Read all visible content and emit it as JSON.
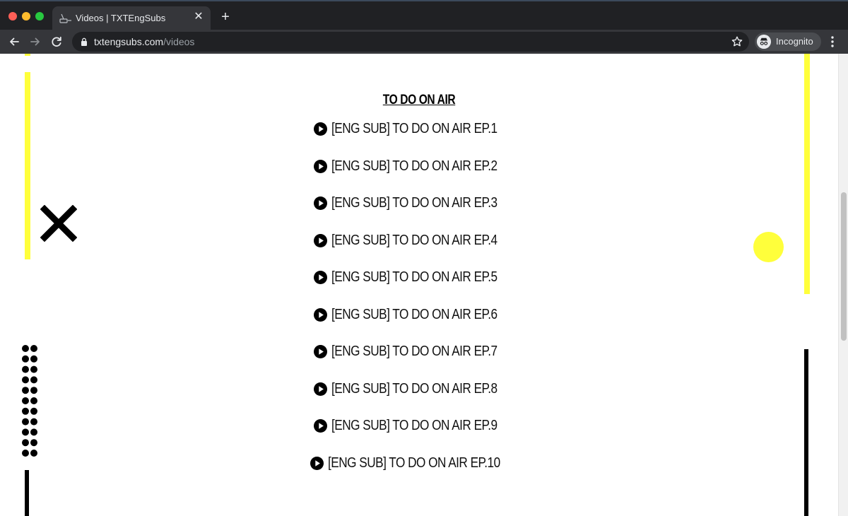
{
  "browser": {
    "tab": {
      "title": "Videos | TXTEngSubs"
    },
    "address": {
      "host": "txtengsubs.com",
      "path": "/videos"
    },
    "profile_label": "Incognito"
  },
  "colors": {
    "accent_yellow": "#ffff3b",
    "chrome_dark": "#202124",
    "chrome_mid": "#35363a"
  },
  "content": {
    "heading": "TO DO ON AIR",
    "episodes": [
      {
        "label": "[ENG SUB] TO DO ON AIR EP.1"
      },
      {
        "label": "[ENG SUB] TO DO ON AIR EP.2"
      },
      {
        "label": "[ENG SUB] TO DO ON AIR EP.3"
      },
      {
        "label": "[ENG SUB] TO DO ON AIR EP.4"
      },
      {
        "label": "[ENG SUB] TO DO ON AIR EP.5"
      },
      {
        "label": "[ENG SUB] TO DO ON AIR EP.6"
      },
      {
        "label": "[ENG SUB] TO DO ON AIR EP.7"
      },
      {
        "label": "[ENG SUB] TO DO ON AIR EP.8"
      },
      {
        "label": "[ENG SUB] TO DO ON AIR EP.9"
      },
      {
        "label": "[ENG SUB] TO DO ON AIR EP.10"
      }
    ]
  }
}
